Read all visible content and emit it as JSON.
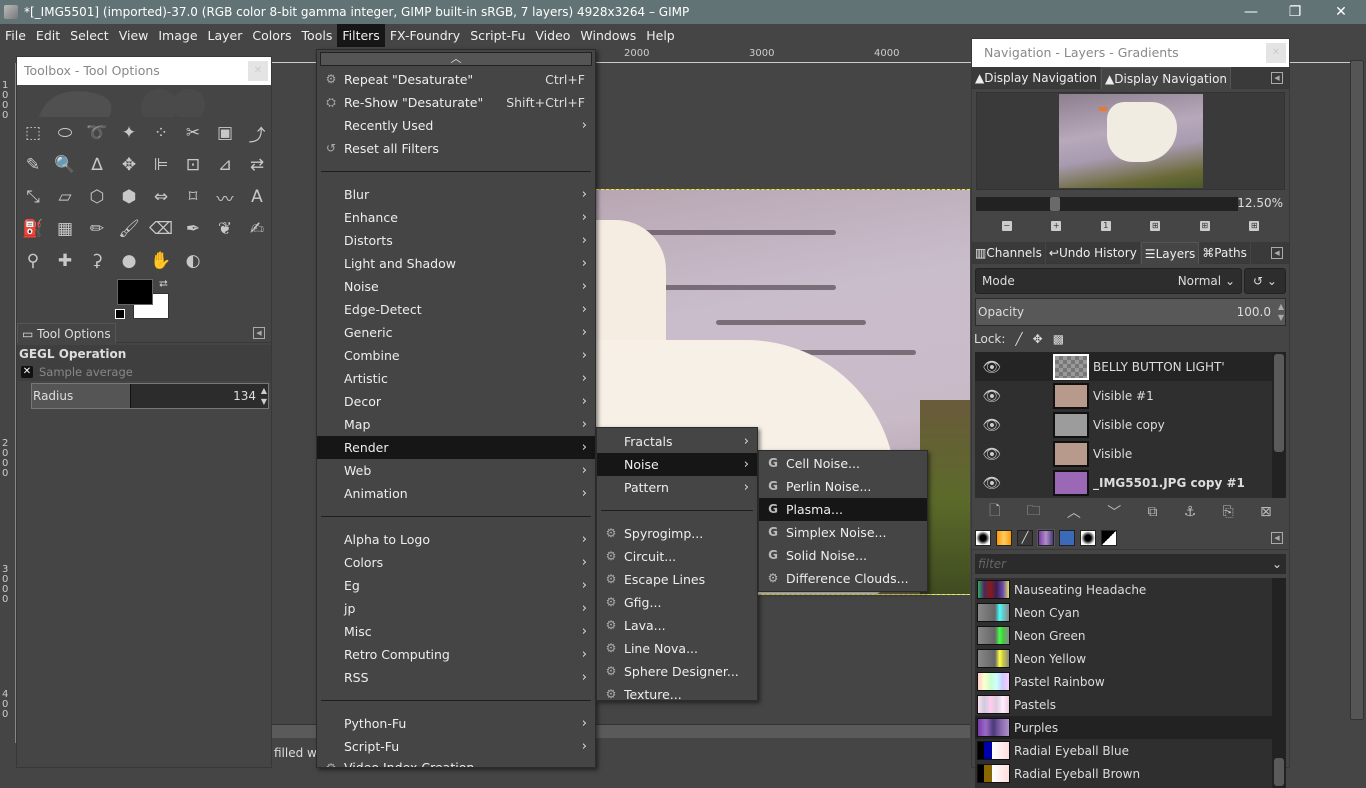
{
  "window": {
    "title": "*[_IMG5501] (imported)-37.0 (RGB color 8-bit gamma integer, GIMP built-in sRGB, 7 layers) 4928x3264 – GIMP",
    "controls": {
      "minimize": "—",
      "restore": "❐",
      "close": "✕"
    }
  },
  "menubar": [
    "File",
    "Edit",
    "Select",
    "View",
    "Image",
    "Layer",
    "Colors",
    "Tools",
    "Filters",
    "FX-Foundry",
    "Script-Fu",
    "Video",
    "Windows",
    "Help"
  ],
  "menubar_active": "Filters",
  "rulers": {
    "horizontal": [
      "2000",
      "3000",
      "4000"
    ],
    "vertical": [
      "1000",
      "2000",
      "3000",
      "400"
    ]
  },
  "status": {
    "text": "filled wi"
  },
  "toolbox": {
    "title": "Toolbox - Tool Options",
    "tools": [
      "rect-select",
      "ellipse-select",
      "free-select",
      "fuzzy-select",
      "by-color-select",
      "scissors-select",
      "foreground-select",
      "paths",
      "color-picker",
      "zoom",
      "measure",
      "move",
      "align",
      "crop",
      "unified-transform",
      "rotate",
      "scale",
      "shear",
      "perspective",
      "3d-transform",
      "flip",
      "cage",
      "warp",
      "text",
      "bucket-fill",
      "gradient",
      "pencil",
      "paintbrush",
      "eraser",
      "airbrush",
      "ink",
      "mypaint-brush",
      "clone",
      "heal",
      "perspective-clone",
      "blur",
      "smudge",
      "dodge-burn"
    ],
    "tool_glyphs": [
      "⬚",
      "⬭",
      "➰",
      "✦",
      "⁘",
      "✂",
      "▣",
      "⤴",
      "✎",
      "🔍",
      "∆",
      "✥",
      "⊫",
      "⊡",
      "⊿",
      "⇄",
      "⤡",
      "▱",
      "⬡",
      "⬢",
      "⇔",
      "⌑",
      "〰",
      "A",
      "⛽",
      "▦",
      "✏",
      "🖌",
      "⌫",
      "✒",
      "❦",
      "✍",
      "⚲",
      "✚",
      "⚳",
      "●",
      "✋",
      "◐"
    ],
    "fg_color": "#000000",
    "bg_color": "#ffffff",
    "tool_options_tab": "Tool Options",
    "gegl_heading": "GEGL Operation",
    "sample_average_label": "Sample average",
    "radius_label": "Radius",
    "radius_value": "134",
    "radius_fraction": 0.42
  },
  "filters_menu": {
    "top_items": [
      {
        "label": "Repeat \"Desaturate\"",
        "shortcut": "Ctrl+F",
        "icon": "gear-icon"
      },
      {
        "label": "Re-Show \"Desaturate\"",
        "shortcut": "Shift+Ctrl+F",
        "icon": "reshow-icon"
      },
      {
        "label": "Recently Used",
        "submenu": true
      },
      {
        "label": "Reset all Filters",
        "icon": "reset-icon"
      }
    ],
    "categories": [
      "Blur",
      "Enhance",
      "Distorts",
      "Light and Shadow",
      "Noise",
      "Edge-Detect",
      "Generic",
      "Combine",
      "Artistic",
      "Decor",
      "Map",
      "Render",
      "Web",
      "Animation"
    ],
    "highlighted": "Render",
    "scripts": [
      "Alpha to Logo",
      "Colors",
      "Eg",
      "jp",
      "Misc",
      "Retro Computing",
      "RSS"
    ],
    "fu": [
      "Python-Fu",
      "Script-Fu"
    ],
    "bottom": "Video Index Creation"
  },
  "render_menu": {
    "submenus": [
      "Fractals",
      "Noise",
      "Pattern"
    ],
    "highlighted": "Noise",
    "items": [
      "Spyrogimp...",
      "Circuit...",
      "Escape Lines",
      "Gfig...",
      "Lava...",
      "Line Nova...",
      "Sphere Designer...",
      "Texture..."
    ]
  },
  "noise_menu": {
    "items": [
      {
        "label": "Cell Noise...",
        "icon": "G"
      },
      {
        "label": "Perlin Noise...",
        "icon": "G"
      },
      {
        "label": "Plasma...",
        "icon": "G"
      },
      {
        "label": "Simplex Noise...",
        "icon": "G"
      },
      {
        "label": "Solid Noise...",
        "icon": "G"
      },
      {
        "label": "Difference Clouds...",
        "icon": "gear"
      }
    ],
    "highlighted": "Plasma..."
  },
  "dock": {
    "title": "Navigation - Layers - Gradients",
    "nav_tabs": [
      "Display Navigation",
      "Display Navigation"
    ],
    "zoom_value": "12.50%",
    "zoom_fraction": 0.3,
    "layer_tabs": [
      "Channels",
      "Undo History",
      "Layers",
      "Paths"
    ],
    "active_layer_tab": "Layers",
    "mode_label": "Mode",
    "mode_value": "Normal",
    "opacity_label": "Opacity",
    "opacity_value": "100.0",
    "lock_label": "Lock:",
    "layers": [
      {
        "name": "BELLY BUTTON LIGHT'",
        "selected": true,
        "thumb": "transparent"
      },
      {
        "name": "Visible #1",
        "thumb": "#b89a8c"
      },
      {
        "name": "Visible copy",
        "thumb": "#9c9c9c"
      },
      {
        "name": "Visible",
        "thumb": "#b89a8c"
      },
      {
        "name": "_IMG5501.JPG copy #1",
        "thumb": "#9a68b4",
        "bold": true
      }
    ],
    "filter_placeholder": "filter",
    "gradients": [
      {
        "name": "Nauseating Headache",
        "swatch": "linear-gradient(90deg,#3a6,#4a2a5a,#8a1a1a,#3a2050,#6a4aaa,#e0e060)"
      },
      {
        "name": "Neon Cyan",
        "swatch": "linear-gradient(90deg,#888 0,#666 55%,#4ff 70%,#6cc 80%,#888)"
      },
      {
        "name": "Neon Green",
        "swatch": "linear-gradient(90deg,#888 0,#666 55%,#4f4 70%,#4c4 80%,#888)"
      },
      {
        "name": "Neon Yellow",
        "swatch": "linear-gradient(90deg,#888 0,#666 55%,#ff4 70%,#cc4 80%,#888)"
      },
      {
        "name": "Pastel Rainbow",
        "swatch": "linear-gradient(90deg,#fcc,#ffc,#cfc,#cff,#ccf,#fcf)"
      },
      {
        "name": "Pastels",
        "swatch": "linear-gradient(90deg,#fde,#ccd,#fce,#dcd,#fef,#ecd)"
      },
      {
        "name": "Purples",
        "swatch": "linear-gradient(90deg,#7a3aa8,#9a6ac8,#4a3a7a,#8a6ab0,#b090c8)",
        "selected": true
      },
      {
        "name": "Radial Eyeball Blue",
        "swatch": "linear-gradient(90deg,#000 0,#000 20%,#00a 20%,#00a 45%,#fff 45%,#fdd)"
      },
      {
        "name": "Radial Eyeball Brown",
        "swatch": "linear-gradient(90deg,#000 0,#000 20%,#860 20%,#860 45%,#fff 45%,#fdd)"
      }
    ]
  }
}
